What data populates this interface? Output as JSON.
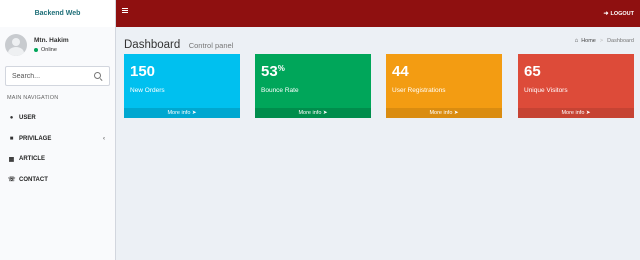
{
  "brand": "Backend Web",
  "user": {
    "name": "Mtn. Hakim",
    "status": "Online"
  },
  "search": {
    "placeholder": "Search..."
  },
  "nav": {
    "header": "MAIN NAVIGATION",
    "items": [
      {
        "label": "USER",
        "icon": "user-icon"
      },
      {
        "label": "PRIVILAGE",
        "icon": "lock-icon"
      },
      {
        "label": "ARTICLE",
        "icon": "book-icon"
      },
      {
        "label": "CONTACT",
        "icon": "phone-icon"
      }
    ]
  },
  "topbar": {
    "logout_label": "LOGOUT"
  },
  "page": {
    "title": "Dashboard",
    "subtitle": "Control panel"
  },
  "breadcrumb": {
    "home": "Home",
    "current": "Dashboard"
  },
  "boxes": [
    {
      "value": "150",
      "suffix": "",
      "label": "New Orders",
      "footer": "More info",
      "color": "#00c0ef",
      "footer_color": "#00a7d0"
    },
    {
      "value": "53",
      "suffix": "%",
      "label": "Bounce Rate",
      "footer": "More info",
      "color": "#00a65a",
      "footer_color": "#008d4c"
    },
    {
      "value": "44",
      "suffix": "",
      "label": "User Registrations",
      "footer": "More info",
      "color": "#f39c12",
      "footer_color": "#da8c10"
    },
    {
      "value": "65",
      "suffix": "",
      "label": "Unique Visitors",
      "footer": "More info",
      "color": "#dd4b39",
      "footer_color": "#c64333"
    }
  ]
}
